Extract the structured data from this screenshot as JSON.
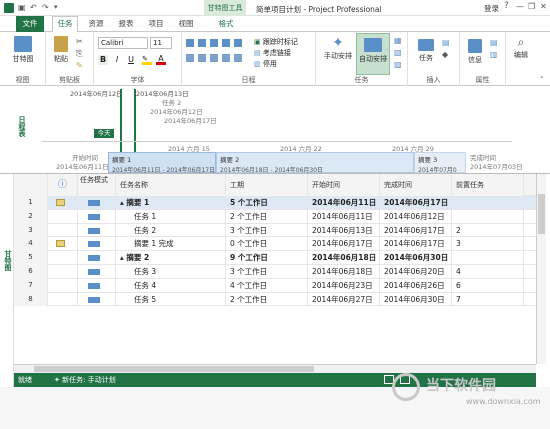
{
  "titlebar": {
    "quick_icons": [
      "save-icon",
      "undo-icon",
      "redo-icon",
      "dropdown-icon"
    ],
    "context_tab": "甘特图工具",
    "title": "简单项目计划 - Project Professional",
    "login": "登录",
    "help": "?",
    "minimize": "—",
    "restore": "❐",
    "close": "✕"
  },
  "tabs": {
    "file": "文件",
    "items": [
      "任务",
      "资源",
      "报表",
      "项目",
      "视图"
    ],
    "format": "格式"
  },
  "ribbon": {
    "view": {
      "btn": "甘特图",
      "label": "视图"
    },
    "clipboard": {
      "paste": "粘贴",
      "label": "剪贴板"
    },
    "font": {
      "name": "Calibri",
      "size": "11",
      "bold": "B",
      "italic": "I",
      "underline": "U",
      "label": "字体"
    },
    "schedule": {
      "track": "跟踪时标记",
      "respect": "考虑链接",
      "inactivate": "停用",
      "label": "日程"
    },
    "tasks": {
      "manual": "手动安排",
      "auto": "自动安排",
      "label": "任务"
    },
    "insert": {
      "task": "任务",
      "label": "插入"
    },
    "properties": {
      "info": "信息",
      "label": "属性"
    },
    "editing": {
      "edit": "编辑"
    }
  },
  "timeline": {
    "side_label": "日程表",
    "today": "今天",
    "dates_top": [
      "2014年06月12日",
      "2014年06月13日"
    ],
    "milestone": {
      "name": "任务 2",
      "date": "2014年06月12日",
      "date2": "2014年06月17日"
    },
    "scale": [
      "2014 六月 15",
      "2014 六月 22",
      "2014 六月 29"
    ],
    "start_label": "开始时间",
    "start_date": "2014年06月11日",
    "end_label": "完成时间",
    "end_date": "2014年07月03日",
    "bars": [
      {
        "name": "摘要 1",
        "range": "2014年06月11日 - 2014年06月17日"
      },
      {
        "name": "摘要 2",
        "range": "2014年06月18日 - 2014年06月30日"
      },
      {
        "name": "摘要 3",
        "range": "2014年07月0"
      }
    ]
  },
  "grid": {
    "side_label": "甘特图",
    "headers": {
      "info": "ⓘ",
      "mode": "任务模式",
      "name": "任务名称",
      "duration": "工期",
      "start": "开始时间",
      "finish": "完成时间",
      "pred": "前置任务"
    },
    "rows": [
      {
        "id": "1",
        "note": true,
        "name": "▴ 摘要 1",
        "duration": "5 个工作日",
        "start": "2014年06月11日",
        "finish": "2014年06月17日",
        "pred": "",
        "bold": true,
        "indent": 0
      },
      {
        "id": "2",
        "note": false,
        "name": "任务 1",
        "duration": "2 个工作日",
        "start": "2014年06月11日",
        "finish": "2014年06月12日",
        "pred": "",
        "bold": false,
        "indent": 1
      },
      {
        "id": "3",
        "note": false,
        "name": "任务 2",
        "duration": "3 个工作日",
        "start": "2014年06月13日",
        "finish": "2014年06月17日",
        "pred": "2",
        "bold": false,
        "indent": 1
      },
      {
        "id": "4",
        "note": true,
        "name": "摘要 1 完成",
        "duration": "0 个工作日",
        "start": "2014年06月17日",
        "finish": "2014年06月17日",
        "pred": "3",
        "bold": false,
        "indent": 1
      },
      {
        "id": "5",
        "note": false,
        "name": "▴ 摘要 2",
        "duration": "9 个工作日",
        "start": "2014年06月18日",
        "finish": "2014年06月30日",
        "pred": "",
        "bold": true,
        "indent": 0
      },
      {
        "id": "6",
        "note": false,
        "name": "任务 3",
        "duration": "3 个工作日",
        "start": "2014年06月18日",
        "finish": "2014年06月20日",
        "pred": "4",
        "bold": false,
        "indent": 1
      },
      {
        "id": "7",
        "note": false,
        "name": "任务 4",
        "duration": "4 个工作日",
        "start": "2014年06月23日",
        "finish": "2014年06月26日",
        "pred": "6",
        "bold": false,
        "indent": 1
      },
      {
        "id": "8",
        "note": false,
        "name": "任务 5",
        "duration": "2 个工作日",
        "start": "2014年06月27日",
        "finish": "2014年06月30日",
        "pred": "7",
        "bold": false,
        "indent": 1
      }
    ]
  },
  "status": {
    "ready": "就绪",
    "new_tasks": "新任务: 手动计划"
  },
  "watermark": {
    "site": "当下软件园",
    "url": "www.downxia.com"
  },
  "colors": {
    "accent": "#217346",
    "bar": "#5b8fc7",
    "summary_bar": "#cfe0f2"
  }
}
